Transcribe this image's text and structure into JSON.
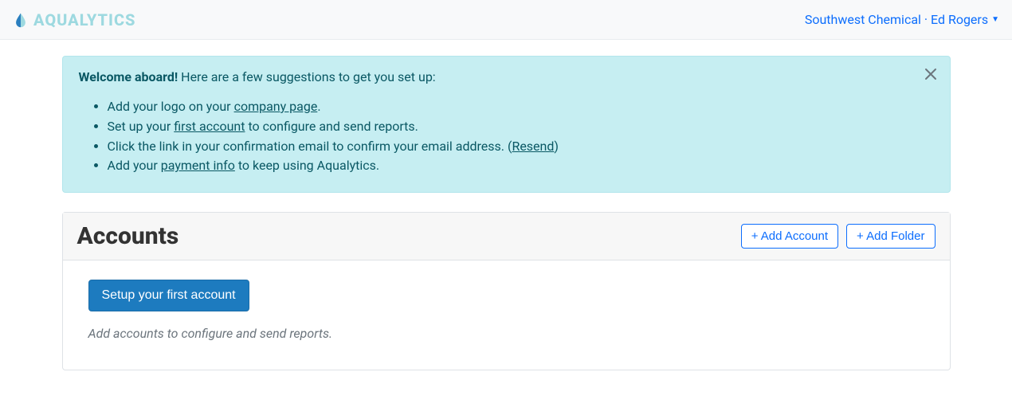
{
  "brand": {
    "name": "AQUALYTICS"
  },
  "user_menu": {
    "label": "Southwest Chemical · Ed Rogers"
  },
  "alert": {
    "heading": "Welcome aboard!",
    "sub": " Here are a few suggestions to get you set up:",
    "items": {
      "i1": {
        "pre": "Add your logo on your ",
        "link": "company page",
        "post": "."
      },
      "i2": {
        "pre": "Set up your ",
        "link": "first account",
        "post": " to configure and send reports."
      },
      "i3": {
        "pre": "Click the link in your confirmation email to confirm your email address. (",
        "link": "Resend",
        "post": ")"
      },
      "i4": {
        "pre": "Add your ",
        "link": "payment info",
        "post": " to keep using Aqualytics."
      }
    }
  },
  "accounts": {
    "title": "Accounts",
    "add_account": "+ Add Account",
    "add_folder": "+ Add Folder",
    "setup_button": "Setup your first account",
    "hint": "Add accounts to configure and send reports."
  }
}
